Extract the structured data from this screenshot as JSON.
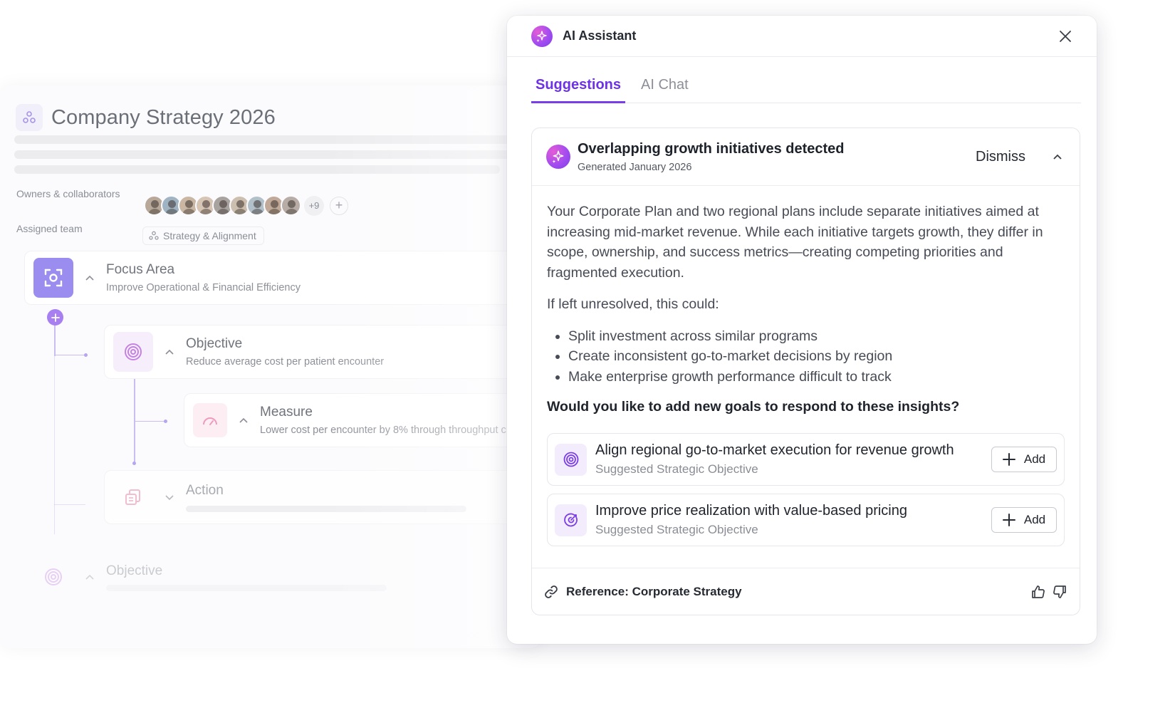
{
  "strategy": {
    "title": "Company Strategy 2026",
    "owners_label": "Owners & collaborators",
    "more_owners": "+9",
    "add_symbol": "+",
    "team_label": "Assigned team",
    "team_name": "Strategy & Alignment",
    "avatar_colors": [
      "#b8a89a",
      "#9fb3c2",
      "#c9b7a3",
      "#d6c4b5",
      "#a9a3a0",
      "#cdbfb0",
      "#b2c0c9",
      "#c0a998",
      "#b7ada6"
    ],
    "nodes": {
      "focus": {
        "title": "Focus Area",
        "subtitle": "Improve Operational & Financial Efficiency"
      },
      "objective": {
        "title": "Objective",
        "subtitle": "Reduce average cost per patient encounter"
      },
      "measure": {
        "title": "Measure",
        "subtitle": "Lower cost per encounter by 8% through throughput c"
      },
      "action": {
        "title": "Action"
      },
      "objective2": {
        "title": "Objective"
      }
    }
  },
  "assistant": {
    "title": "AI Assistant",
    "tabs": [
      {
        "label": "Suggestions",
        "active": true
      },
      {
        "label": "AI Chat",
        "active": false
      }
    ],
    "insight": {
      "title": "Overlapping growth initiatives detected",
      "date": "Generated January 2026",
      "dismiss_label": "Dismiss",
      "paragraph1": "Your Corporate Plan and two regional plans include separate initiatives aimed at increasing mid-market revenue. While each initiative targets growth, they differ in scope, ownership, and success metrics—creating competing priorities and fragmented execution.",
      "paragraph2": "If left unresolved, this could:",
      "bullets": [
        "Split investment across similar programs",
        "Create inconsistent go-to-market decisions by region",
        "Make enterprise growth performance difficult to track"
      ],
      "question": "Would you like to add new goals to respond to these insights?",
      "suggestions": [
        {
          "title": "Align regional go-to-market execution for revenue growth",
          "subtitle": "Suggested Strategic Objective",
          "icon": "target-icon",
          "add_label": "Add"
        },
        {
          "title": "Improve price realization with value-based pricing",
          "subtitle": "Suggested Strategic Objective",
          "icon": "target-arrow-icon",
          "add_label": "Add"
        }
      ],
      "reference": "Reference: Corporate Strategy"
    }
  },
  "colors": {
    "accent": "#7a3ee8",
    "focus_bg": "#9b8cf0"
  }
}
